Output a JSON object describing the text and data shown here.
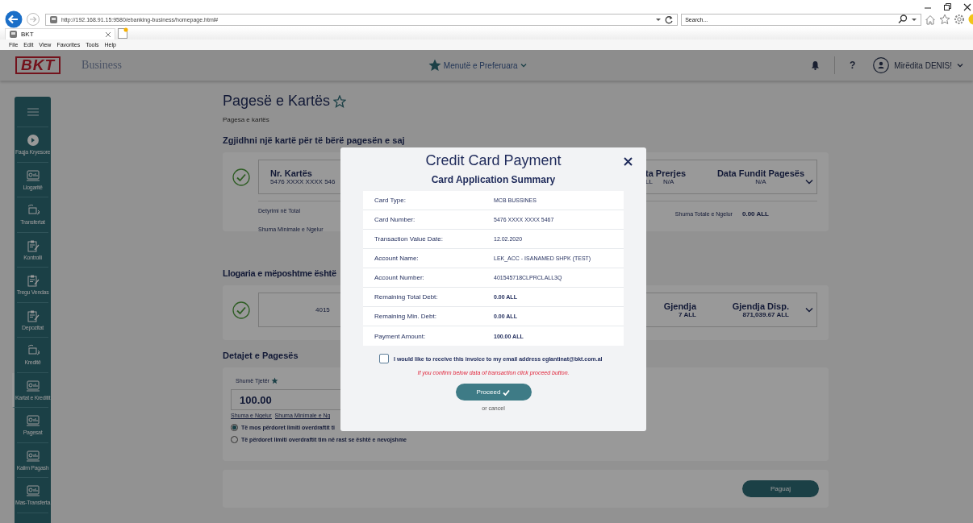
{
  "browser": {
    "address": "http://192.168.91.15:9580/ebanking-business/homepage.html#",
    "search_placeholder": "Search...",
    "tab_title": "BKT",
    "menu": [
      "File",
      "Edit",
      "View",
      "Favorites",
      "Tools",
      "Help"
    ]
  },
  "header": {
    "logo": "BKT",
    "product": "Business",
    "favorites": "Menutë e Preferuara",
    "help": "?",
    "greeting": "Mirëdita DENIS!"
  },
  "sidebar": {
    "items": [
      {
        "label": "Faqja Kryesore",
        "kind": "home",
        "selected": false
      },
      {
        "label": "Llogaritë",
        "kind": "screen",
        "selected": false
      },
      {
        "label": "Transfertat",
        "kind": "transfer",
        "selected": false
      },
      {
        "label": "Kontrolli",
        "kind": "clipboard",
        "selected": false
      },
      {
        "label": "Tregu Vendas",
        "kind": "clipboard",
        "selected": false
      },
      {
        "label": "Depozitat",
        "kind": "clipboard",
        "selected": false
      },
      {
        "label": "Kreditë",
        "kind": "transfer",
        "selected": false
      },
      {
        "label": "Kartat e Kreditit",
        "kind": "screen",
        "selected": true
      },
      {
        "label": "Pagesat",
        "kind": "screen",
        "selected": false
      },
      {
        "label": "Kalim Pagash",
        "kind": "screen",
        "selected": false
      },
      {
        "label": "Mas-Transferta",
        "kind": "screen",
        "selected": false
      }
    ]
  },
  "page": {
    "title": "Pagesë e Kartës",
    "breadcrumb": "Pagesa e kartës",
    "card_section": {
      "heading": "Zgjidhni një kartë për të bërë pagesën e saj",
      "card_number_label": "Nr. Kartës",
      "card_number": "5476 XXXX XXXX 546",
      "column_3_label": "ta Prerjes",
      "column_3_value": "LL",
      "column_3_date": "N/A",
      "last_payment_label": "Data Fundit Pagesës",
      "last_payment_value": "N/A",
      "total_debt_label": "Detyrimi në Total",
      "min_debt_label": "Shuma Minimale e Ngelur",
      "remaining_total_label": "Shuma Totale e Ngelur",
      "remaining_total_value": "0.00 ALL"
    },
    "account_section": {
      "heading": "Llogaria e mëposhtme është",
      "account_number": "4015",
      "balance_value": "7 ALL",
      "balance_label": "Gjendja",
      "available_label": "Gjendja Disp.",
      "available_value": "871,039.67 ALL"
    },
    "details": {
      "heading": "Detajet e Pagesës",
      "amount_label": "Shumë Tjetër",
      "amount_value": "100.00",
      "links": [
        "Shuma e Ngelur",
        "Shuma Minimale e Ng"
      ],
      "options": [
        {
          "label": "Të mos përdoret limiti overdraftit ti",
          "selected": true
        },
        {
          "label": "Të përdoret limiti overdraftit tim në rast se është e nevojshme",
          "selected": false
        }
      ]
    },
    "pay_button": "Paguaj"
  },
  "modal": {
    "title": "Credit Card Payment",
    "subtitle": "Card Application Summary",
    "rows": [
      {
        "label": "Card Type:",
        "value": "MCB BUSSINES",
        "bold": false
      },
      {
        "label": "Card Number:",
        "value": "5476 XXXX XXXX 5467",
        "bold": false
      },
      {
        "label": "Transaction Value Date:",
        "value": "12.02.2020",
        "bold": false
      },
      {
        "label": "Account Name:",
        "value": "LEK_ACC - ISANAMED SHPK (TEST)",
        "bold": false
      },
      {
        "label": "Account Number:",
        "value": "401545718CLPRCLALL3Q",
        "bold": false
      },
      {
        "label": "Remaining Total Debt:",
        "value": "0.00 ALL",
        "bold": true
      },
      {
        "label": "Remaining Min. Debt:",
        "value": "0.00 ALL",
        "bold": true
      },
      {
        "label": "Payment Amount:",
        "value": "100.00 ALL",
        "bold": true
      }
    ],
    "email_opt_in": {
      "label": "I would like to receive this invoice to my email address eglantinat@bkt.com.al",
      "checked": false
    },
    "warning": "If you confirm below data of transaction click proceed button.",
    "proceed": "Proceed",
    "cancel": "or cancel"
  }
}
